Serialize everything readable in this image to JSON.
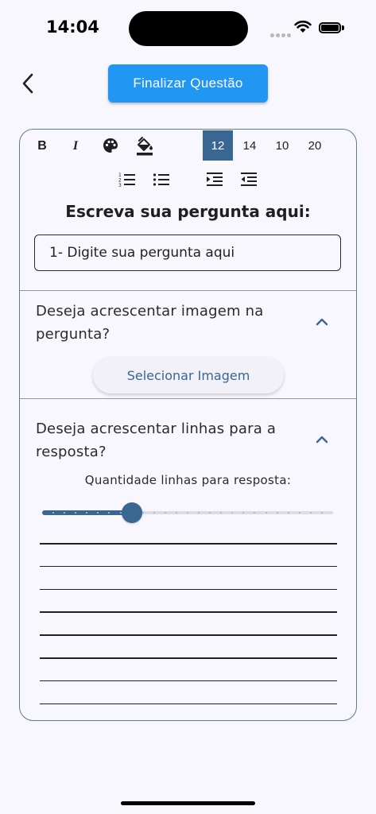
{
  "status": {
    "time": "14:04"
  },
  "toolbar": {
    "finalize_label": "Finalizar Questão",
    "font_sizes": [
      "12",
      "14",
      "10",
      "20"
    ],
    "selected_font_size": "12",
    "bold_label": "B",
    "italic_label": "I",
    "icons": [
      "bold-icon",
      "italic-icon",
      "palette-icon",
      "fill-color-icon",
      "ordered-list-icon",
      "bullet-list-icon",
      "indent-icon",
      "outdent-icon"
    ]
  },
  "question": {
    "heading": "Escreva sua pergunta aqui:",
    "input_value": "1- Digite sua pergunta aqui"
  },
  "image_section": {
    "title": "Deseja acrescentar imagem na pergunta?",
    "button_label": "Selecionar Imagem"
  },
  "lines_section": {
    "title": "Deseja acrescentar linhas para a resposta?",
    "quantity_label": "Quantidade linhas para resposta:",
    "slider_value": 8,
    "slider_max": 26,
    "line_count": 8
  },
  "colors": {
    "accent_button": "#2196f3",
    "primary": "#3a6692",
    "background": "#f7f7fd"
  }
}
